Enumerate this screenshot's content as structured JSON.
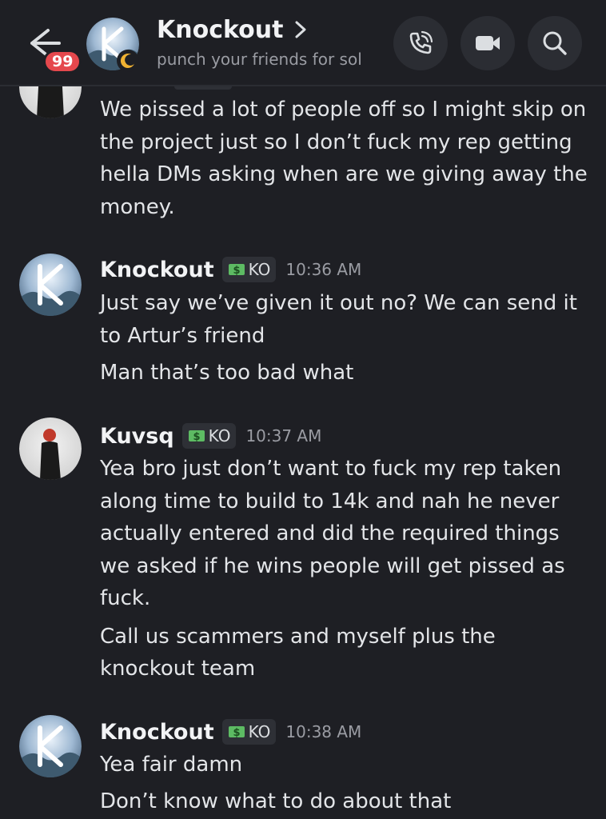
{
  "header": {
    "unread_count": "99",
    "server_name": "Knockout",
    "topic": "punch your friends for sol"
  },
  "messages": [
    {
      "author": "",
      "continued_lines": [
        "We pissed a lot of people off so I might skip on",
        "the project just so I don’t fuck my rep getting",
        "hella DMs asking when are we giving away the",
        "money."
      ]
    },
    {
      "author": "Knockout",
      "tag": "KO",
      "time": "10:36 AM",
      "lines": [
        "Just say we’ve given it out no? We can send it",
        "to Artur’s friend",
        "Man that’s too bad what"
      ]
    },
    {
      "author": "Kuvsq",
      "tag": "KO",
      "time": "10:37 AM",
      "lines": [
        "Yea bro just don’t want to fuck my rep taken",
        "along time to build to 14k and nah he never",
        "actually entered and did the required things",
        "we asked if he wins people will get pissed as",
        "fuck.",
        "Call us scammers and myself plus the",
        "knockout team"
      ]
    },
    {
      "author": "Knockout",
      "tag": "KO",
      "time": "10:38 AM",
      "lines": [
        "Yea fair damn",
        "Don’t know what to do about that"
      ]
    }
  ],
  "icons": {
    "back": "back-arrow-icon",
    "call": "phone-icon",
    "video": "video-camera-icon",
    "search": "search-icon",
    "tag_icon": "money-icon",
    "status": "idle-moon-icon"
  },
  "colors": {
    "background": "#1e1f24",
    "badge": "#e5484d",
    "idle": "#f0b232"
  }
}
